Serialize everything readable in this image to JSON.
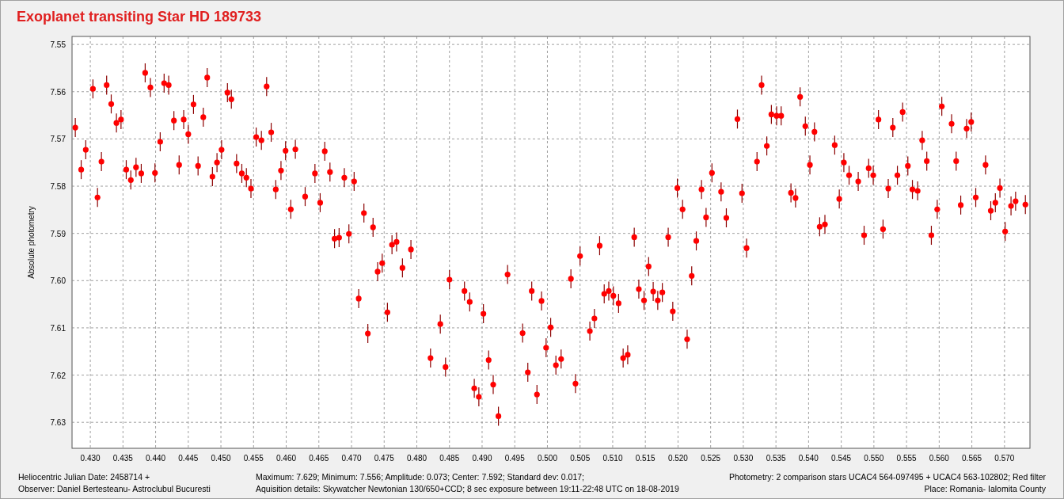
{
  "window": {
    "title": "Exoplanet transiting Star HD 189733"
  },
  "chart": {
    "chart_data": {
      "type": "scatter",
      "ylabel": "Absolute photometry",
      "xlim": [
        0.4272,
        0.5739
      ],
      "ylim": [
        7.6355,
        7.5483
      ],
      "grid": true,
      "xticks": [
        {
          "value": 0.43,
          "label": "0.430"
        },
        {
          "value": 0.435,
          "label": "0.435"
        },
        {
          "value": 0.44,
          "label": "0.440"
        },
        {
          "value": 0.445,
          "label": "0.445"
        },
        {
          "value": 0.45,
          "label": "0.450"
        },
        {
          "value": 0.455,
          "label": "0.455"
        },
        {
          "value": 0.46,
          "label": "0.460"
        },
        {
          "value": 0.465,
          "label": "0.465"
        },
        {
          "value": 0.47,
          "label": "0.470"
        },
        {
          "value": 0.475,
          "label": "0.475"
        },
        {
          "value": 0.48,
          "label": "0.480"
        },
        {
          "value": 0.485,
          "label": "0.485"
        },
        {
          "value": 0.49,
          "label": "0.490"
        },
        {
          "value": 0.495,
          "label": "0.495"
        },
        {
          "value": 0.5,
          "label": "0.500"
        },
        {
          "value": 0.505,
          "label": "0.505"
        },
        {
          "value": 0.51,
          "label": "0.510"
        },
        {
          "value": 0.515,
          "label": "0.515"
        },
        {
          "value": 0.52,
          "label": "0.520"
        },
        {
          "value": 0.525,
          "label": "0.525"
        },
        {
          "value": 0.53,
          "label": "0.530"
        },
        {
          "value": 0.535,
          "label": "0.535"
        },
        {
          "value": 0.54,
          "label": "0.540"
        },
        {
          "value": 0.545,
          "label": "0.545"
        },
        {
          "value": 0.55,
          "label": "0.550"
        },
        {
          "value": 0.555,
          "label": "0.555"
        },
        {
          "value": 0.56,
          "label": "0.560"
        },
        {
          "value": 0.565,
          "label": "0.565"
        },
        {
          "value": 0.57,
          "label": "0.570"
        }
      ],
      "yticks": [
        {
          "value": 7.55,
          "label": "7.55"
        },
        {
          "value": 7.56,
          "label": "7.56"
        },
        {
          "value": 7.57,
          "label": "7.57"
        },
        {
          "value": 7.58,
          "label": "7.58"
        },
        {
          "value": 7.59,
          "label": "7.59"
        },
        {
          "value": 7.6,
          "label": "7.60"
        },
        {
          "value": 7.61,
          "label": "7.61"
        },
        {
          "value": 7.62,
          "label": "7.62"
        },
        {
          "value": 7.63,
          "label": "7.63"
        }
      ],
      "x": [
        0.4277,
        0.4286,
        0.4293,
        0.4304,
        0.4311,
        0.4317,
        0.4325,
        0.4332,
        0.434,
        0.4347,
        0.4355,
        0.4362,
        0.437,
        0.4378,
        0.4384,
        0.4392,
        0.4399,
        0.4407,
        0.4413,
        0.442,
        0.4428,
        0.4436,
        0.4443,
        0.445,
        0.4458,
        0.4465,
        0.4473,
        0.4479,
        0.4487,
        0.4494,
        0.4501,
        0.451,
        0.4516,
        0.4524,
        0.4532,
        0.4539,
        0.4546,
        0.4554,
        0.4562,
        0.457,
        0.4577,
        0.4584,
        0.4592,
        0.4599,
        0.4607,
        0.4614,
        0.4629,
        0.4644,
        0.4652,
        0.4659,
        0.4667,
        0.4674,
        0.4681,
        0.4689,
        0.4696,
        0.4704,
        0.4711,
        0.4719,
        0.4725,
        0.4733,
        0.474,
        0.4747,
        0.4755,
        0.4762,
        0.4769,
        0.4778,
        0.4791,
        0.4821,
        0.4836,
        0.4844,
        0.485,
        0.4873,
        0.4881,
        0.4888,
        0.4895,
        0.4902,
        0.491,
        0.4917,
        0.4925,
        0.4939,
        0.4962,
        0.497,
        0.4976,
        0.4984,
        0.4991,
        0.4998,
        0.5005,
        0.5013,
        0.5021,
        0.5036,
        0.5043,
        0.505,
        0.5065,
        0.5072,
        0.508,
        0.5087,
        0.5094,
        0.5101,
        0.5109,
        0.5116,
        0.5123,
        0.5133,
        0.514,
        0.5148,
        0.5155,
        0.5162,
        0.5169,
        0.5176,
        0.5185,
        0.5192,
        0.5199,
        0.5207,
        0.5214,
        0.5221,
        0.5228,
        0.5236,
        0.5243,
        0.5252,
        0.5266,
        0.5274,
        0.5291,
        0.5298,
        0.5305,
        0.5321,
        0.5328,
        0.5336,
        0.5343,
        0.5351,
        0.5358,
        0.5373,
        0.538,
        0.5387,
        0.5395,
        0.5402,
        0.5409,
        0.5417,
        0.5425,
        0.544,
        0.5447,
        0.5454,
        0.5462,
        0.5476,
        0.5485,
        0.5492,
        0.5499,
        0.5507,
        0.5514,
        0.5522,
        0.5529,
        0.5536,
        0.5544,
        0.5552,
        0.5559,
        0.5567,
        0.5574,
        0.5581,
        0.5588,
        0.5597,
        0.5604,
        0.5619,
        0.5626,
        0.5633,
        0.5642,
        0.5649,
        0.5656,
        0.5671,
        0.5679,
        0.5686,
        0.5693,
        0.5701,
        0.571,
        0.5717,
        0.5732
      ],
      "series": [
        {
          "color": "#ff0000",
          "values": [
            7.5676,
            7.5765,
            7.5723,
            7.5594,
            7.5824,
            7.5748,
            7.5586,
            7.5626,
            7.5666,
            7.5659,
            7.5765,
            7.5787,
            7.576,
            7.5773,
            7.556,
            7.5591,
            7.5772,
            7.5706,
            7.5582,
            7.5586,
            7.5661,
            7.5755,
            7.5659,
            7.569,
            7.5627,
            7.5757,
            7.5654,
            7.557,
            7.578,
            7.575,
            7.5723,
            7.5602,
            7.5616,
            7.5752,
            7.5773,
            7.5782,
            7.5805,
            7.5696,
            7.5703,
            7.5589,
            7.5686,
            7.5807,
            7.5767,
            7.5725,
            7.5849,
            7.5722,
            7.5822,
            7.5773,
            7.5835,
            7.5726,
            7.577,
            7.5911,
            7.5909,
            7.5782,
            7.5901,
            7.579,
            7.6038,
            7.5857,
            7.6112,
            7.5887,
            7.5981,
            7.5963,
            7.6067,
            7.5924,
            7.5918,
            7.5973,
            7.5934,
            7.6164,
            7.6092,
            7.6183,
            7.5998,
            7.6022,
            7.6045,
            7.6228,
            7.6246,
            7.607,
            7.6168,
            7.622,
            7.6287,
            7.5987,
            7.6111,
            7.6194,
            7.6022,
            7.6241,
            7.6043,
            7.6142,
            7.6099,
            7.6179,
            7.6166,
            7.5996,
            7.6218,
            7.5948,
            7.6107,
            7.608,
            7.5926,
            7.6028,
            7.6022,
            7.6032,
            7.6048,
            7.6164,
            7.6157,
            7.5908,
            7.6018,
            7.6042,
            7.597,
            7.6023,
            7.6042,
            7.6025,
            7.5908,
            7.6065,
            7.5804,
            7.5849,
            7.6124,
            7.599,
            7.5916,
            7.5807,
            7.5866,
            7.5772,
            7.5812,
            7.5867,
            7.5658,
            7.5815,
            7.5931,
            7.5748,
            7.5586,
            7.5715,
            7.5648,
            7.5651,
            7.5651,
            7.5814,
            7.5825,
            7.5611,
            7.5673,
            7.5755,
            7.5685,
            7.5886,
            7.5881,
            7.5713,
            7.5827,
            7.575,
            7.5777,
            7.579,
            7.5904,
            7.5762,
            7.5777,
            7.5659,
            7.5891,
            7.5805,
            7.5676,
            7.5777,
            7.5643,
            7.5757,
            7.5807,
            7.581,
            7.5703,
            7.5747,
            7.5904,
            7.5849,
            7.5631,
            7.5668,
            7.5747,
            7.584,
            7.5678,
            7.5664,
            7.5824,
            7.5755,
            7.5852,
            7.5835,
            7.5804,
            7.5896,
            7.5842,
            7.5832,
            7.5839
          ]
        }
      ]
    }
  },
  "footer": {
    "left": [
      "Heliocentric Julian Date: 2458714 +",
      "Observer: Daniel Bertesteanu- Astroclubul Bucuresti"
    ],
    "middle": [
      "Maximum: 7.629;  Minimum: 7.556;  Amplitude: 0.073;  Center: 7.592;  Standard dev: 0.017;",
      "Aquisition details: Skywatcher Newtonian 130/650+CCD; 8 sec exposure between 19:11-22:48 UTC on 18-08-2019"
    ],
    "right": [
      "Photometry: 2 comparison stars UCAC4 564-097495 + UCAC4 563-102802; Red filter",
      "Place: Romania- Ialomita County"
    ]
  }
}
